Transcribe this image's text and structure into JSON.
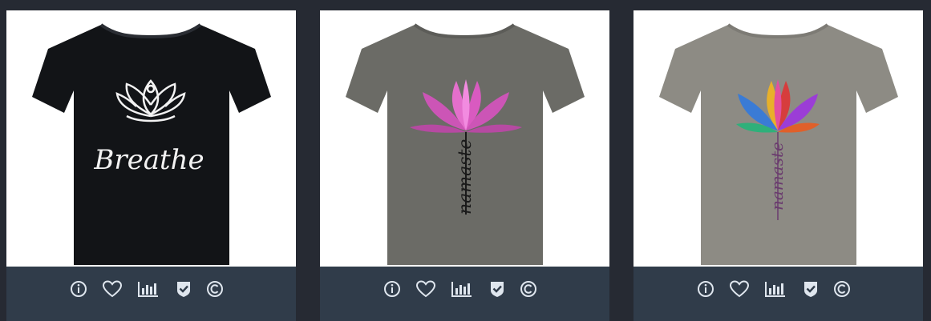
{
  "products": [
    {
      "shirt_color": "#121417",
      "design": "breathe-lotus",
      "design_text": "Breathe",
      "actions": [
        "info-icon",
        "heart-icon",
        "chart-icon",
        "shield-check-icon",
        "copyright-icon"
      ]
    },
    {
      "shirt_color": "#6b6b66",
      "design": "pink-lotus-namaste",
      "design_text": "namaste",
      "actions": [
        "info-icon",
        "heart-icon",
        "chart-icon",
        "shield-check-icon",
        "copyright-icon"
      ]
    },
    {
      "shirt_color": "#8d8b84",
      "design": "multicolor-lotus-namaste",
      "design_text": "namaste",
      "actions": [
        "info-icon",
        "heart-icon",
        "chart-icon",
        "shield-check-icon",
        "copyright-icon"
      ]
    }
  ],
  "colors": {
    "page_background": "#262a33",
    "card_footer": "#303c4a",
    "icon": "#dfe6ee"
  }
}
